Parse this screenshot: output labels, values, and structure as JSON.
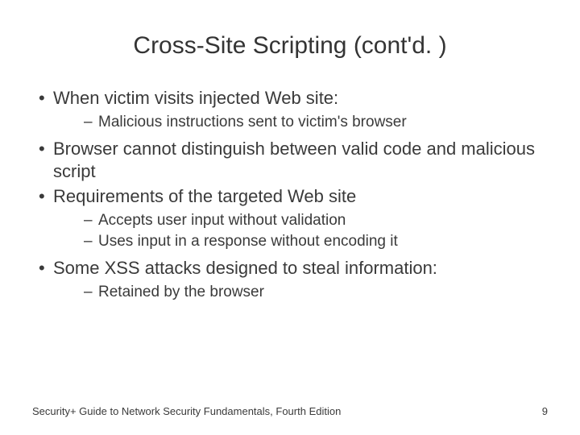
{
  "title": "Cross-Site Scripting (cont'd. )",
  "bullets": [
    {
      "text": "When victim visits injected Web site:",
      "children": [
        "Malicious instructions sent to victim's browser"
      ]
    },
    {
      "text": "Browser cannot distinguish between valid code and malicious script",
      "children": []
    },
    {
      "text": "Requirements of the targeted Web site",
      "children": [
        "Accepts user input without validation",
        "Uses input in a response without encoding it"
      ]
    },
    {
      "text": "Some XSS attacks designed to steal information:",
      "children": [
        "Retained by the browser"
      ]
    }
  ],
  "footer": {
    "source": "Security+ Guide to Network Security Fundamentals, Fourth Edition",
    "page": "9"
  }
}
